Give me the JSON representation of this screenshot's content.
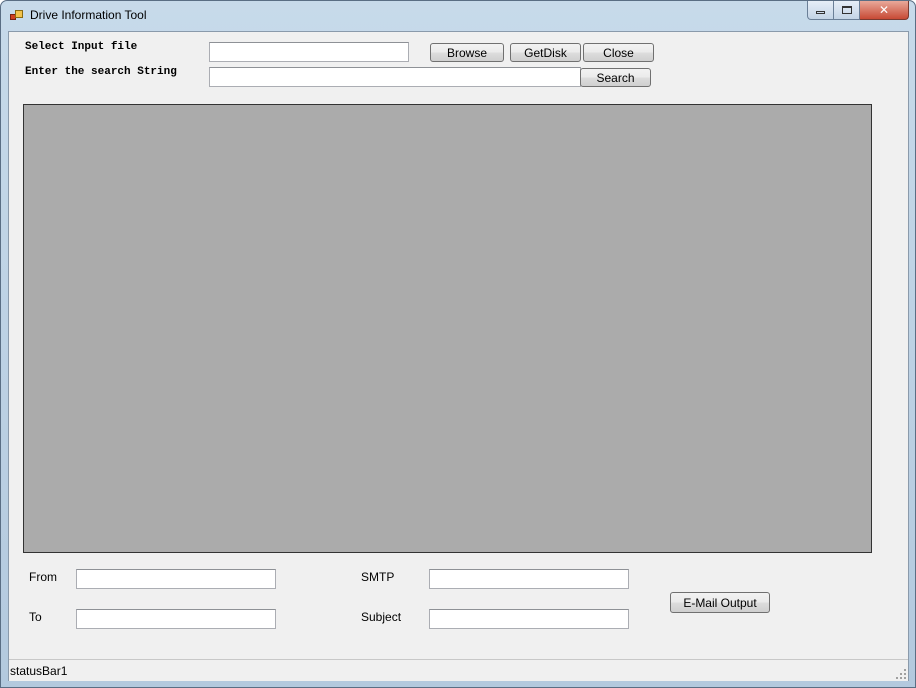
{
  "window": {
    "title": "Drive Information Tool",
    "icon": "app-icon"
  },
  "caption": {
    "minimize_icon": "minimize-icon",
    "maximize_icon": "maximize-icon",
    "close_glyph": "✕"
  },
  "input_section": {
    "select_file_label": "Select Input file",
    "file_value": "",
    "search_label": "Enter the search String",
    "search_value": "",
    "browse_button": "Browse",
    "getdisk_button": "GetDisk",
    "close_button": "Close",
    "search_button": "Search"
  },
  "email_section": {
    "from_label": "From",
    "from_value": "",
    "to_label": "To",
    "to_value": "",
    "smtp_label": "SMTP",
    "smtp_value": "",
    "subject_label": "Subject",
    "subject_value": "",
    "email_button": "E-Mail Output"
  },
  "statusbar": {
    "text": "statusBar1"
  },
  "colors": {
    "viewer_background": "#ababab",
    "form_background": "#f0f0f0"
  }
}
